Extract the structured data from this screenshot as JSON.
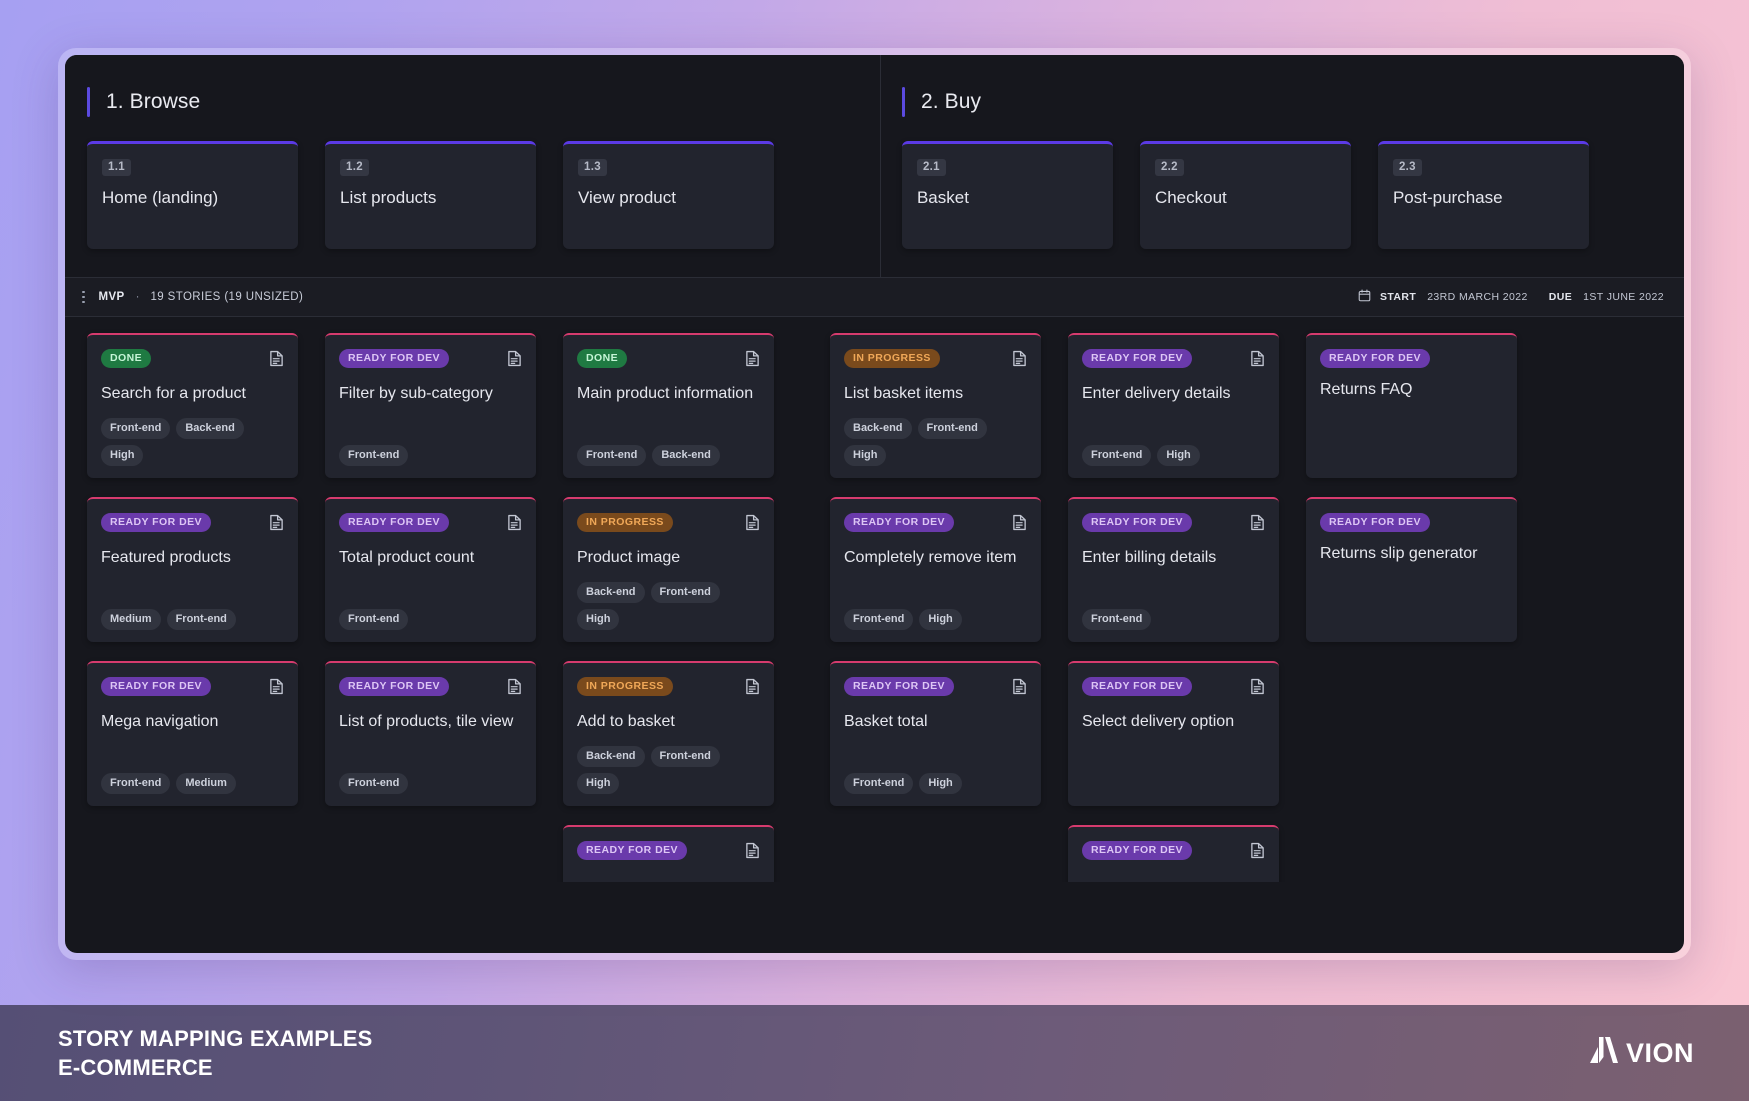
{
  "footer": {
    "line1": "STORY MAPPING EXAMPLES",
    "line2": "E-COMMERCE",
    "brand": "VION",
    "brand_icon": "avion-logo-mark"
  },
  "colors": {
    "accent_purple": "#5b3ae6",
    "story_top_border": "#d63b6e",
    "status_done_bg": "#1f7a42",
    "status_ready_bg": "#6a3aab",
    "status_inprogress_bg": "#7a4a1c",
    "card_bg": "#22242e",
    "board_bg": "#16171d",
    "gradient_start": "#a6a0f2",
    "gradient_end": "#f9c6d3"
  },
  "activities": [
    {
      "title": "1. Browse"
    },
    {
      "title": "2. Buy"
    }
  ],
  "steps": [
    {
      "num": "1.1",
      "name": "Home (landing)",
      "activity": 0
    },
    {
      "num": "1.2",
      "name": "List products",
      "activity": 0
    },
    {
      "num": "1.3",
      "name": "View product",
      "activity": 0
    },
    {
      "num": "2.1",
      "name": "Basket",
      "activity": 1
    },
    {
      "num": "2.2",
      "name": "Checkout",
      "activity": 1
    },
    {
      "num": "2.3",
      "name": "Post-purchase",
      "activity": 1
    }
  ],
  "release": {
    "menu_icon": "kebab-menu-icon",
    "name": "MVP",
    "separator": "·",
    "count": "19 STORIES (19 UNSIZED)",
    "calendar_icon": "calendar-icon",
    "start_label": "START",
    "start_value": "23RD MARCH 2022",
    "due_label": "DUE",
    "due_value": "1ST JUNE 2022"
  },
  "doc_icon_name": "document-icon",
  "story_columns": [
    {
      "step": "1.1",
      "stories": [
        {
          "status": "DONE",
          "status_kind": "done",
          "title": "Search for a product",
          "has_doc": true,
          "tags": [
            "Front-end",
            "Back-end",
            "High"
          ]
        },
        {
          "status": "READY FOR DEV",
          "status_kind": "ready",
          "title": "Featured products",
          "has_doc": true,
          "tags": [
            "Medium",
            "Front-end"
          ]
        },
        {
          "status": "READY FOR DEV",
          "status_kind": "ready",
          "title": "Mega navigation",
          "has_doc": true,
          "tags": [
            "Front-end",
            "Medium"
          ]
        }
      ]
    },
    {
      "step": "1.2",
      "stories": [
        {
          "status": "READY FOR DEV",
          "status_kind": "ready",
          "title": "Filter by sub-category",
          "has_doc": true,
          "tags": [
            "Front-end"
          ]
        },
        {
          "status": "READY FOR DEV",
          "status_kind": "ready",
          "title": "Total product count",
          "has_doc": true,
          "tags": [
            "Front-end"
          ]
        },
        {
          "status": "READY FOR DEV",
          "status_kind": "ready",
          "title": "List of products, tile view",
          "has_doc": true,
          "tags": [
            "Front-end"
          ]
        }
      ]
    },
    {
      "step": "1.3",
      "stories": [
        {
          "status": "DONE",
          "status_kind": "done",
          "title": "Main product information",
          "has_doc": true,
          "tags": [
            "Front-end",
            "Back-end"
          ]
        },
        {
          "status": "IN PROGRESS",
          "status_kind": "inprogress",
          "title": "Product image",
          "has_doc": true,
          "tags": [
            "Back-end",
            "Front-end",
            "High"
          ]
        },
        {
          "status": "IN PROGRESS",
          "status_kind": "inprogress",
          "title": "Add to basket",
          "has_doc": true,
          "tags": [
            "Back-end",
            "Front-end",
            "High"
          ]
        },
        {
          "status": "READY FOR DEV",
          "status_kind": "ready",
          "title": "",
          "has_doc": true,
          "tags": [],
          "partial": true
        }
      ]
    },
    {
      "step": "2.1",
      "stories": [
        {
          "status": "IN PROGRESS",
          "status_kind": "inprogress",
          "title": "List basket items",
          "has_doc": true,
          "tags": [
            "Back-end",
            "Front-end",
            "High"
          ]
        },
        {
          "status": "READY FOR DEV",
          "status_kind": "ready",
          "title": "Completely remove item",
          "has_doc": true,
          "tags": [
            "Front-end",
            "High"
          ]
        },
        {
          "status": "READY FOR DEV",
          "status_kind": "ready",
          "title": "Basket total",
          "has_doc": true,
          "tags": [
            "Front-end",
            "High"
          ]
        }
      ]
    },
    {
      "step": "2.2",
      "stories": [
        {
          "status": "READY FOR DEV",
          "status_kind": "ready",
          "title": "Enter delivery details",
          "has_doc": true,
          "tags": [
            "Front-end",
            "High"
          ]
        },
        {
          "status": "READY FOR DEV",
          "status_kind": "ready",
          "title": "Enter billing details",
          "has_doc": true,
          "tags": [
            "Front-end"
          ]
        },
        {
          "status": "READY FOR DEV",
          "status_kind": "ready",
          "title": "Select delivery option",
          "has_doc": true,
          "tags": []
        },
        {
          "status": "READY FOR DEV",
          "status_kind": "ready",
          "title": "",
          "has_doc": true,
          "tags": [],
          "partial": true
        }
      ]
    },
    {
      "step": "2.3",
      "stories": [
        {
          "status": "READY FOR DEV",
          "status_kind": "ready",
          "title": "Returns FAQ",
          "has_doc": false,
          "tags": []
        },
        {
          "status": "READY FOR DEV",
          "status_kind": "ready",
          "title": "Returns slip generator",
          "has_doc": false,
          "tags": []
        }
      ]
    }
  ]
}
